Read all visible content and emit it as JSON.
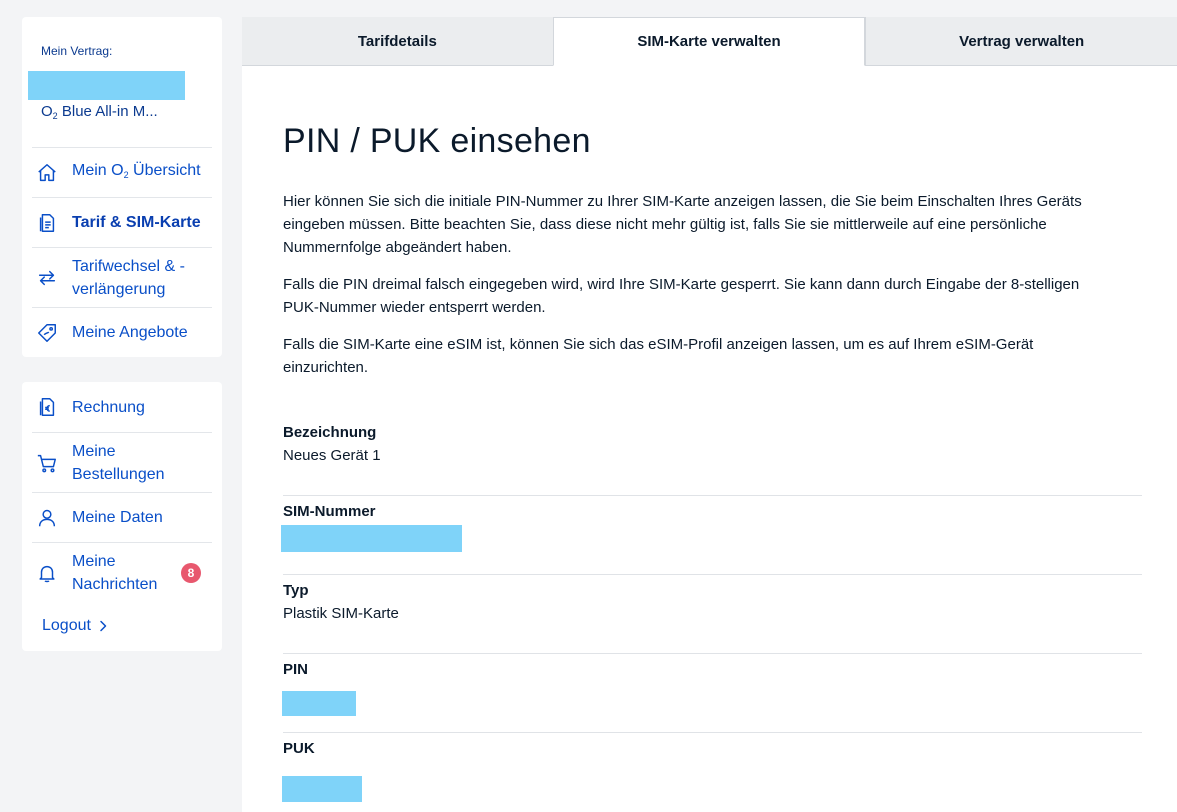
{
  "sidebar": {
    "contract_label": "Mein Vertrag:",
    "contract_name_prefix": "O",
    "contract_name_sub": "2",
    "contract_name_rest": " Blue All-in M...",
    "nav_main": [
      {
        "prefix": "Mein O",
        "sub": "2",
        "rest": " Übersicht",
        "icon": "home-icon",
        "active": false
      },
      {
        "label": "Tarif & SIM-Karte",
        "icon": "document-icon",
        "active": true
      },
      {
        "label": "Tarifwechsel & -verlängerung",
        "line1": "Tarifwechsel & -",
        "line2": "verlängerung",
        "icon": "swap-arrows-icon",
        "active": false
      },
      {
        "label": "Meine Angebote",
        "icon": "tag-icon",
        "active": false
      }
    ],
    "nav_secondary": [
      {
        "label": "Rechnung",
        "icon": "invoice-euro-icon"
      },
      {
        "line1": "Meine",
        "line2": "Bestellungen",
        "icon": "cart-icon"
      },
      {
        "label": "Meine Daten",
        "icon": "user-icon"
      },
      {
        "line1": "Meine",
        "line2": "Nachrichten",
        "icon": "bell-icon",
        "badge": "8"
      }
    ],
    "logout_label": "Logout"
  },
  "tabs": [
    {
      "label": "Tarifdetails",
      "active": false
    },
    {
      "label": "SIM-Karte verwalten",
      "active": true
    },
    {
      "label": "Vertrag verwalten",
      "active": false
    }
  ],
  "main": {
    "title": "PIN / PUK einsehen",
    "paragraphs": [
      "Hier können Sie sich die initiale PIN-Nummer zu Ihrer SIM-Karte anzeigen lassen, die Sie beim Einschalten Ihres Geräts eingeben müssen. Bitte beachten Sie, dass diese nicht mehr gültig ist, falls Sie sie mittlerweile auf eine persönliche Nummernfolge abgeändert haben.",
      "Falls die PIN dreimal falsch eingegeben wird, wird Ihre SIM-Karte gesperrt. Sie kann dann durch Eingabe der 8-stelligen PUK-Nummer wieder entsperrt werden.",
      "Falls die SIM-Karte eine eSIM ist, können Sie sich das eSIM-Profil anzeigen lassen, um es auf Ihrem eSIM-Gerät einzurichten."
    ],
    "fields": [
      {
        "label": "Bezeichnung",
        "value": "Neues Gerät 1"
      },
      {
        "label": "SIM-Nummer",
        "value": ""
      },
      {
        "label": "Typ",
        "value": "Plastik SIM-Karte"
      },
      {
        "label": "PIN",
        "value": ""
      },
      {
        "label": "PUK",
        "value": ""
      }
    ]
  },
  "colors": {
    "accent": "#0a4fc8",
    "redaction": "#7fd3f9",
    "badge": "#e8586e",
    "background": "#f3f4f6"
  }
}
